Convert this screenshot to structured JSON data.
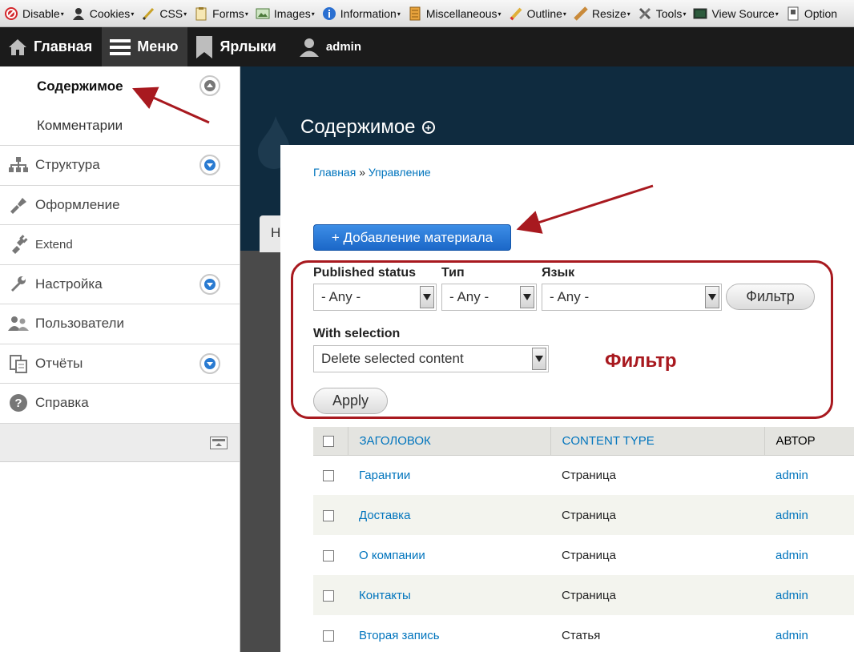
{
  "webdev_toolbar": {
    "items": [
      {
        "label": "Disable",
        "icon": "disable-icon"
      },
      {
        "label": "Cookies",
        "icon": "cookies-icon"
      },
      {
        "label": "CSS",
        "icon": "css-icon"
      },
      {
        "label": "Forms",
        "icon": "forms-icon"
      },
      {
        "label": "Images",
        "icon": "images-icon"
      },
      {
        "label": "Information",
        "icon": "information-icon"
      },
      {
        "label": "Miscellaneous",
        "icon": "miscellaneous-icon"
      },
      {
        "label": "Outline",
        "icon": "outline-icon"
      },
      {
        "label": "Resize",
        "icon": "resize-icon"
      },
      {
        "label": "Tools",
        "icon": "tools-icon"
      },
      {
        "label": "View Source",
        "icon": "view-source-icon"
      },
      {
        "label": "Option",
        "icon": "options-icon"
      }
    ]
  },
  "admin_bar": {
    "home": "Главная",
    "menu": "Меню",
    "shortcuts": "Ярлыки",
    "user": "admin"
  },
  "tray": {
    "active_group": {
      "items": [
        "Содержимое",
        "Комментарии"
      ]
    },
    "items": [
      {
        "label": "Структура",
        "icon": "structure-icon",
        "expandable": true
      },
      {
        "label": "Оформление",
        "icon": "appearance-icon",
        "expandable": false
      },
      {
        "label": "Extend",
        "icon": "extend-icon",
        "expandable": false
      },
      {
        "label": "Настройка",
        "icon": "config-icon",
        "expandable": true
      },
      {
        "label": "Пользователи",
        "icon": "people-icon",
        "expandable": false
      },
      {
        "label": "Отчёты",
        "icon": "reports-icon",
        "expandable": true
      },
      {
        "label": "Справка",
        "icon": "help-icon",
        "expandable": false
      }
    ]
  },
  "page": {
    "title": "Содержимое",
    "breadcrumb": [
      "Главная",
      "Управление"
    ],
    "breadcrumb_sep": "»",
    "add_button": "+ Добавление материала",
    "ghost_tab": "Н"
  },
  "filters": {
    "published_status": {
      "label": "Published status",
      "value": "- Any -"
    },
    "type": {
      "label": "Тип",
      "value": "- Any -"
    },
    "language": {
      "label": "Язык",
      "value": "- Any -"
    },
    "filter_button": "Фильтр",
    "with_selection": {
      "label": "With selection",
      "value": "Delete selected content"
    },
    "apply_button": "Apply",
    "annotation": "Фильтр"
  },
  "table": {
    "headers": [
      "ЗАГОЛОВОК",
      "CONTENT TYPE",
      "АВТОР"
    ],
    "rows": [
      {
        "title": "Гарантии",
        "type": "Страница",
        "author": "admin"
      },
      {
        "title": "Доставка",
        "type": "Страница",
        "author": "admin"
      },
      {
        "title": "О компании",
        "type": "Страница",
        "author": "admin"
      },
      {
        "title": "Контакты",
        "type": "Страница",
        "author": "admin"
      },
      {
        "title": "Вторая запись",
        "type": "Статья",
        "author": "admin"
      }
    ]
  },
  "colors": {
    "accent_link": "#0074bd",
    "annotation_red": "#a8191f",
    "admin_bar_bg": "#1b1b1b",
    "header_dark": "#0f2b3f",
    "primary_button": "#1b67c8"
  }
}
